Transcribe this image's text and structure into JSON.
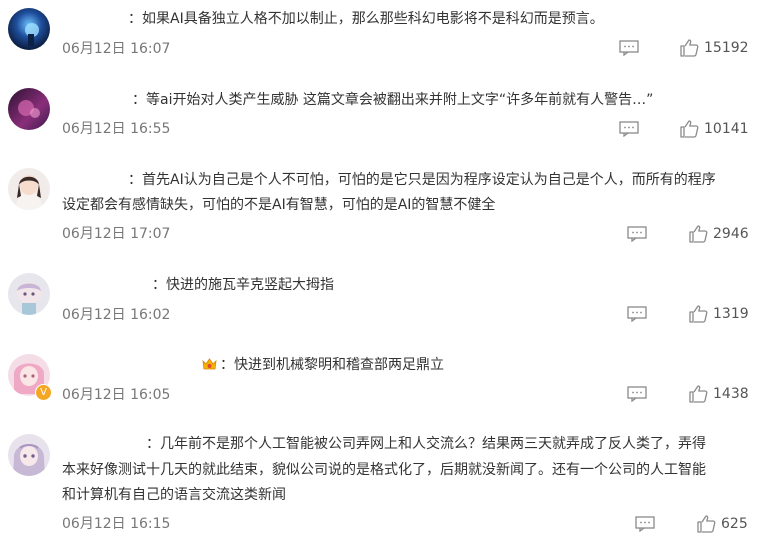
{
  "comments": [
    {
      "text": "：如果AI具备独立人格不加以制止，那么那些科幻电影将不是科幻而是预言。",
      "time": "06月12日 16:07",
      "likes": "15192",
      "avatar_icon": "avatar-dark-blue-icon"
    },
    {
      "text": "：等ai开始对人类产生威胁 这篇文章会被翻出来并附上文字“许多年前就有人警告…”",
      "time": "06月12日 16:55",
      "likes": "10141",
      "avatar_icon": "avatar-purple-pink-icon"
    },
    {
      "text_line1": "：首先AI认为自己是个人不可怕，可怕的是它只是因为程序设定认为自己是个人，而所有的程序",
      "text_line2": "设定都会有感情缺失，可怕的不是AI有智慧，可怕的是AI的智慧不健全",
      "time": "06月12日 17:07",
      "likes": "2946",
      "avatar_icon": "avatar-girl-icon"
    },
    {
      "text": "：快进的施瓦辛克竖起大拇指",
      "time": "06月12日 16:02",
      "likes": "1319",
      "avatar_icon": "avatar-pastel-character-icon"
    },
    {
      "text": "：快进到机械黎明和稽查部两足鼎立",
      "time": "06月12日 16:05",
      "likes": "1438",
      "avatar_icon": "avatar-pink-hair-icon",
      "badge": "V"
    },
    {
      "text_line1": "：几年前不是那个人工智能被公司弄网上和人交流么？结果两三天就弄成了反人类了，弄得",
      "text_line2": "本来好像测试十几天的就此结束，貌似公司说的是格式化了，后期就没新闻了。还有一个公司的人工智能",
      "text_line3": "和计算机有自己的语言交流这类新闻",
      "time": "06月12日 16:15",
      "likes": "625",
      "avatar_icon": "avatar-anime-girl-icon"
    }
  ],
  "colors": {
    "text": "#333333",
    "meta": "#777777",
    "icon": "#8a8a8a",
    "badge": "#f5a623"
  },
  "icons": {
    "reply": "comment-reply-icon",
    "like": "thumbs-up-icon",
    "medal": "medal-badge-icon"
  }
}
